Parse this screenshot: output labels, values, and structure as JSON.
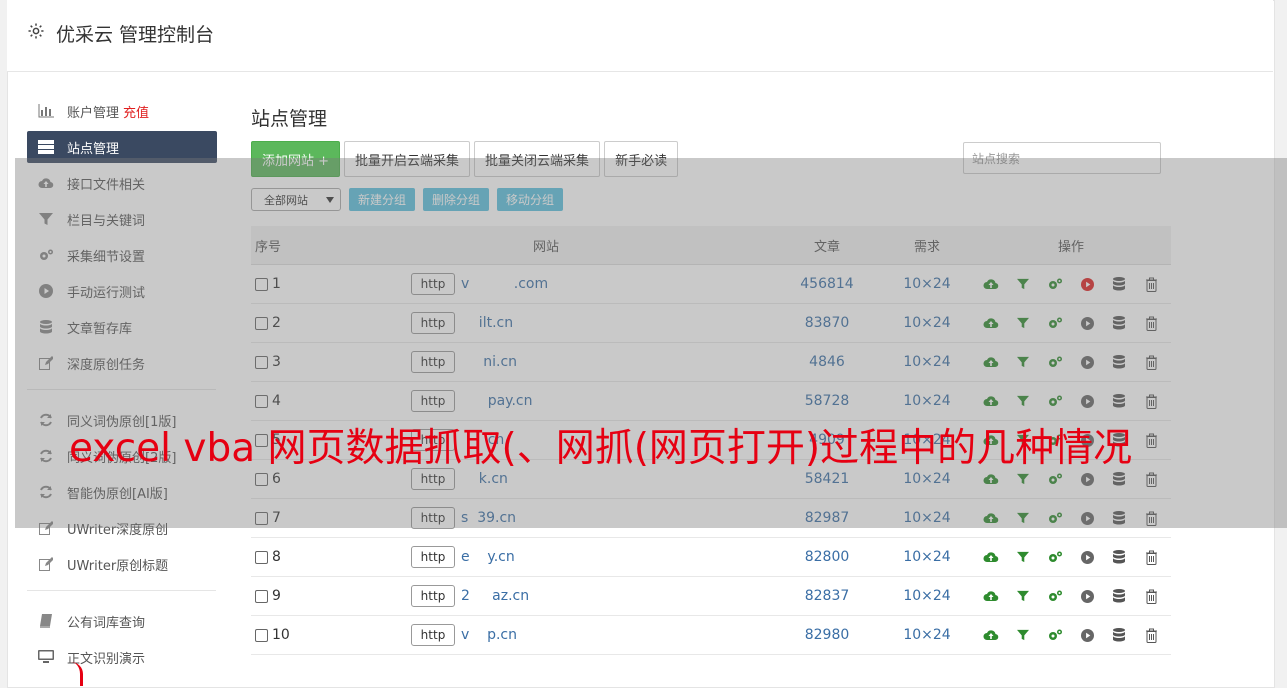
{
  "header": {
    "title": "优采云 管理控制台"
  },
  "sidebar": {
    "items": [
      {
        "label": "账户管理",
        "badge": "充值",
        "icon": "bar-chart-icon"
      },
      {
        "label": "站点管理",
        "icon": "server-icon",
        "active": true
      },
      {
        "label": "接口文件相关",
        "icon": "cloud-upload-icon"
      },
      {
        "label": "栏目与关键词",
        "icon": "filter-icon"
      },
      {
        "label": "采集细节设置",
        "icon": "gears-icon"
      },
      {
        "label": "手动运行测试",
        "icon": "play-circle-icon"
      },
      {
        "label": "文章暂存库",
        "icon": "database-icon"
      },
      {
        "label": "深度原创任务",
        "icon": "edit-icon"
      }
    ],
    "items2": [
      {
        "label": "同义词伪原创[1版]",
        "icon": "refresh-icon"
      },
      {
        "label": "同义词伪原创[2版]",
        "icon": "refresh-icon"
      },
      {
        "label": "智能伪原创[AI版]",
        "icon": "refresh-icon"
      },
      {
        "label": "UWriter深度原创",
        "icon": "edit-icon"
      },
      {
        "label": "UWriter原创标题",
        "icon": "edit-icon"
      }
    ],
    "items3": [
      {
        "label": "公有词库查询",
        "icon": "book-icon"
      },
      {
        "label": "正文识别演示",
        "icon": "desktop-icon"
      }
    ]
  },
  "main": {
    "title": "站点管理",
    "toolbar": {
      "add_site": "添加网站 +",
      "batch_enable": "批量开启云端采集",
      "batch_disable": "批量关闭云端采集",
      "guide": "新手必读"
    },
    "search_placeholder": "站点搜索",
    "group_select": "全部网站",
    "group_buttons": {
      "new": "新建分组",
      "delete": "删除分组",
      "move": "移动分组"
    },
    "table": {
      "headers": {
        "no": "序号",
        "site": "网站",
        "articles": "文章",
        "demand": "需求",
        "ops": "操作"
      },
      "rows": [
        {
          "no": "1",
          "proto": "http",
          "domain": "v          .com",
          "articles": "456814",
          "demand": "10×24",
          "running": true
        },
        {
          "no": "2",
          "proto": "http",
          "domain": "    ilt.cn",
          "articles": "83870",
          "demand": "10×24"
        },
        {
          "no": "3",
          "proto": "http",
          "domain": "     ni.cn",
          "articles": "4846",
          "demand": "10×24"
        },
        {
          "no": "4",
          "proto": "http",
          "domain": "      pay.cn",
          "articles": "58728",
          "demand": "10×24"
        },
        {
          "no": "5",
          "proto": "http",
          "domain": "      cn",
          "articles": "4909",
          "demand": "10×24"
        },
        {
          "no": "6",
          "proto": "http",
          "domain": "    k.cn",
          "articles": "58421",
          "demand": "10×24"
        },
        {
          "no": "7",
          "proto": "http",
          "domain": "s  39.cn",
          "articles": "82987",
          "demand": "10×24"
        },
        {
          "no": "8",
          "proto": "http",
          "domain": "e    y.cn",
          "articles": "82800",
          "demand": "10×24"
        },
        {
          "no": "9",
          "proto": "http",
          "domain": "2     az.cn",
          "articles": "82837",
          "demand": "10×24"
        },
        {
          "no": "10",
          "proto": "http",
          "domain": "v    p.cn",
          "articles": "82980",
          "demand": "10×24"
        }
      ]
    }
  },
  "overlay_caption": "excel vba 网页数据抓取(、网抓(网页打开)过程中的几种情况",
  "colors": {
    "accent_red": "#e60012",
    "sidebar_active": "#3a4961",
    "green": "#5cb85c",
    "info": "#5bc0de",
    "link": "#3a6ea5"
  }
}
